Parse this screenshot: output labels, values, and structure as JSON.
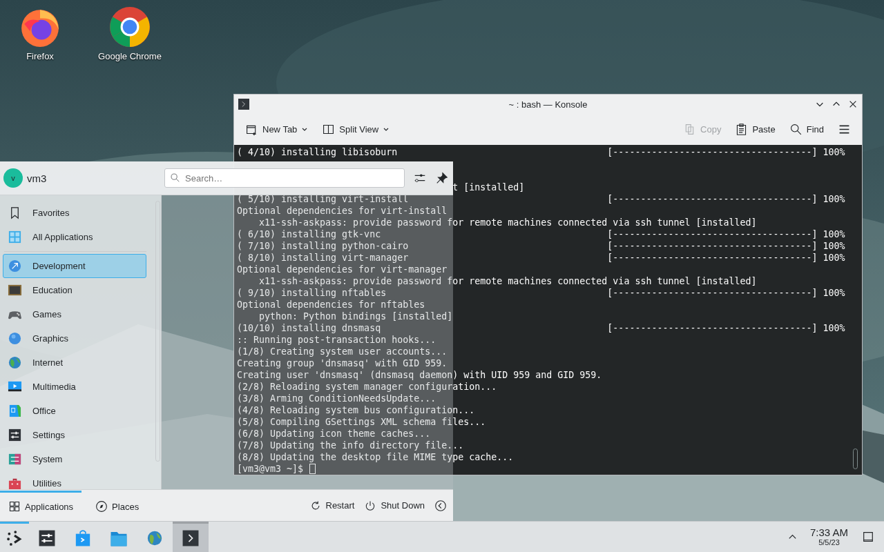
{
  "desktop_icons": [
    {
      "label": "Firefox",
      "kind": "firefox"
    },
    {
      "label": "Google Chrome",
      "kind": "chrome"
    }
  ],
  "konsole": {
    "title": "~ : bash — Konsole",
    "toolbar_left": [
      {
        "label": "New Tab",
        "kind": "new-tab",
        "disabled": false,
        "dropdown": true
      },
      {
        "label": "Split View",
        "kind": "split-view",
        "disabled": false,
        "dropdown": true
      }
    ],
    "toolbar_right": [
      {
        "label": "Copy",
        "kind": "copy",
        "disabled": true,
        "dropdown": false
      },
      {
        "label": "Paste",
        "kind": "paste",
        "disabled": false,
        "dropdown": false
      },
      {
        "label": "Find",
        "kind": "find",
        "disabled": false,
        "dropdown": false
      },
      {
        "kind": "menu",
        "disabled": false,
        "dropdown": false
      }
    ],
    "lines": [
      {
        "text": "( 4/10) installing libisoburn",
        "progress": "[------------------------------------] 100%"
      },
      {
        "kind": "blank"
      },
      {
        "kind": "blank"
      },
      {
        "text": "                                       t [installed]"
      },
      {
        "text": "( 5/10) installing virt-install",
        "progress": "[------------------------------------] 100%"
      },
      {
        "text": "Optional dependencies for virt-install"
      },
      {
        "text": "    x11-ssh-askpass: provide password for remote machines connected via ssh tunnel [installed]"
      },
      {
        "text": "( 6/10) installing gtk-vnc",
        "progress": "[------------------------------------] 100%"
      },
      {
        "text": "( 7/10) installing python-cairo",
        "progress": "[------------------------------------] 100%"
      },
      {
        "text": "( 8/10) installing virt-manager",
        "progress": "[------------------------------------] 100%"
      },
      {
        "text": "Optional dependencies for virt-manager"
      },
      {
        "text": "    x11-ssh-askpass: provide password for remote machines connected via ssh tunnel [installed]"
      },
      {
        "text": "( 9/10) installing nftables",
        "progress": "[------------------------------------] 100%"
      },
      {
        "text": "Optional dependencies for nftables"
      },
      {
        "text": "    python: Python bindings [installed]"
      },
      {
        "text": "(10/10) installing dnsmasq",
        "progress": "[------------------------------------] 100%"
      },
      {
        "text": ":: Running post-transaction hooks..."
      },
      {
        "text": "(1/8) Creating system user accounts..."
      },
      {
        "text": "Creating group 'dnsmasq' with GID 959."
      },
      {
        "text": "Creating user 'dnsmasq' (dnsmasq daemon) with UID 959 and GID 959."
      },
      {
        "text": "(2/8) Reloading system manager configuration..."
      },
      {
        "text": "(3/8) Arming ConditionNeedsUpdate..."
      },
      {
        "text": "(4/8) Reloading system bus configuration..."
      },
      {
        "text": "(5/8) Compiling GSettings XML schema files..."
      },
      {
        "text": "(6/8) Updating icon theme caches..."
      },
      {
        "text": "(7/8) Updating the info directory file..."
      },
      {
        "text": "(8/8) Updating the desktop file MIME type cache..."
      },
      {
        "text": "[vm3@vm3 ~]$",
        "kind": "prompt"
      }
    ]
  },
  "menu": {
    "user": "vm3",
    "avatar_letter": "v",
    "search": {
      "placeholder": "Search…"
    },
    "categories": [
      {
        "label": "Favorites",
        "kind": "favorites",
        "selected": false
      },
      {
        "label": "All Applications",
        "kind": "all",
        "selected": false
      },
      {
        "label": "Development",
        "kind": "development",
        "selected": true
      },
      {
        "label": "Education",
        "kind": "education",
        "selected": false
      },
      {
        "label": "Games",
        "kind": "games",
        "selected": false
      },
      {
        "label": "Graphics",
        "kind": "graphics",
        "selected": false
      },
      {
        "label": "Internet",
        "kind": "internet",
        "selected": false
      },
      {
        "label": "Multimedia",
        "kind": "multimedia",
        "selected": false
      },
      {
        "label": "Office",
        "kind": "office",
        "selected": false
      },
      {
        "label": "Settings",
        "kind": "settings",
        "selected": false
      },
      {
        "label": "System",
        "kind": "system",
        "selected": false
      },
      {
        "label": "Utilities",
        "kind": "utilities",
        "selected": false
      }
    ],
    "tabs": [
      {
        "label": "Applications",
        "kind": "apps",
        "selected": true
      },
      {
        "label": "Places",
        "kind": "places",
        "selected": false
      }
    ],
    "power": [
      {
        "label": "Restart",
        "kind": "restart"
      },
      {
        "label": "Shut Down",
        "kind": "shutdown"
      }
    ]
  },
  "taskbar": {
    "apps": [
      {
        "kind": "launcher",
        "active": true
      },
      {
        "kind": "settings",
        "active": false
      },
      {
        "kind": "discover",
        "active": false
      },
      {
        "kind": "files",
        "active": false
      },
      {
        "kind": "browser",
        "active": false
      },
      {
        "kind": "terminal",
        "active": true
      }
    ],
    "clock": {
      "time": "7:33 AM",
      "date": "5/5/23"
    }
  }
}
